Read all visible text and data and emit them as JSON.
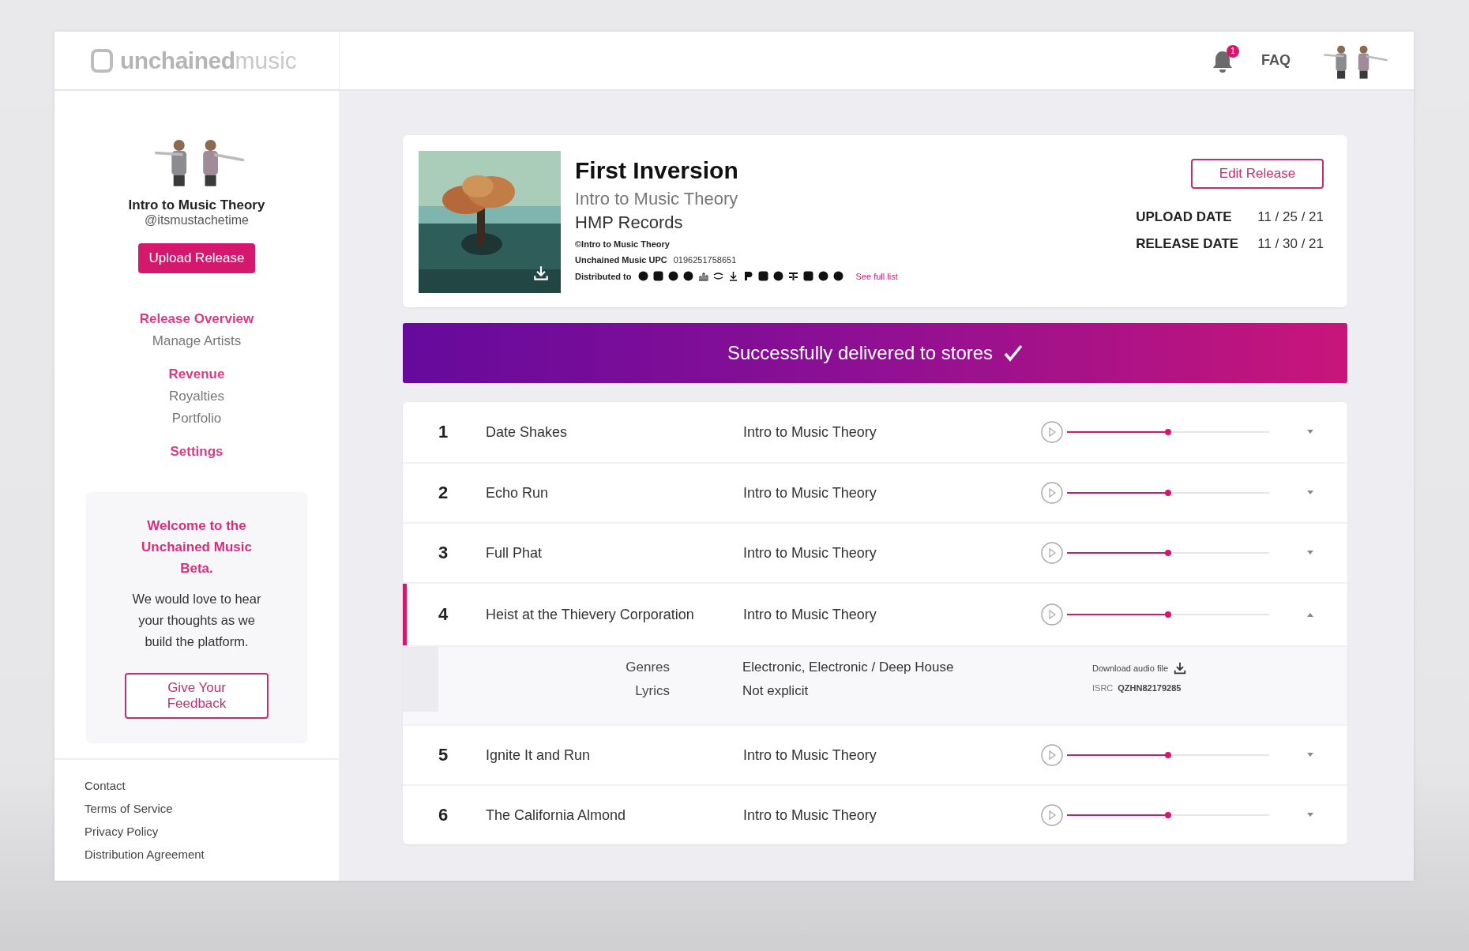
{
  "header": {
    "logo": {
      "bold": "unchained",
      "light": "music"
    },
    "notifications": {
      "badge": "1"
    },
    "faq": "FAQ"
  },
  "sidebar": {
    "profile": {
      "name": "Intro to Music Theory",
      "handle": "@itsmustachetime"
    },
    "upload_button": "Upload Release",
    "nav": [
      {
        "heading": "Release Overview",
        "items": [
          "Manage Artists"
        ]
      },
      {
        "heading": "Revenue",
        "items": [
          "Royalties",
          "Portfolio"
        ]
      },
      {
        "heading": "Settings"
      }
    ],
    "feedback": {
      "title": "Welcome to the Unchained Music Beta.",
      "text": "We would love to hear your thoughts as we build the platform.",
      "button": "Give Your Feedback"
    },
    "footer_links": [
      "Contact",
      "Terms of Service",
      "Privacy Policy",
      "Distribution Agreement"
    ]
  },
  "release": {
    "title": "First Inversion",
    "artist": "Intro to Music Theory",
    "label": "HMP Records",
    "copyright": "©Intro to Music Theory",
    "upc_label": "Unchained Music UPC",
    "upc": "0196251758651",
    "distributed_label": "Distributed to",
    "see_full_list": "See full list",
    "edit_button": "Edit Release",
    "dates": [
      {
        "label": "UPLOAD DATE",
        "value": "11 / 25 / 21"
      },
      {
        "label": "RELEASE DATE",
        "value": "11 / 30 / 21"
      }
    ]
  },
  "banner": {
    "text": "Successfully delivered to stores"
  },
  "tracks": [
    {
      "number": "1",
      "title": "Date Shakes",
      "artist": "Intro to Music Theory",
      "level": 0.5,
      "expanded": false
    },
    {
      "number": "2",
      "title": "Echo Run",
      "artist": "Intro to Music Theory",
      "level": 0.5,
      "expanded": false
    },
    {
      "number": "3",
      "title": "Full Phat",
      "artist": "Intro to Music Theory",
      "level": 0.5,
      "expanded": false
    },
    {
      "number": "4",
      "title": "Heist at the Thievery Corporation",
      "artist": "Intro to Music Theory",
      "level": 0.5,
      "expanded": true,
      "details": [
        {
          "label": "Genres",
          "value": "Electronic, Electronic / Deep House"
        },
        {
          "label": "Lyrics",
          "value": "Not explicit"
        }
      ],
      "download_label": "Download audio file",
      "isrc_label": "ISRC",
      "isrc": "QZHN82179285"
    },
    {
      "number": "5",
      "title": "Ignite It and Run",
      "artist": "Intro to Music Theory",
      "level": 0.5,
      "expanded": false
    },
    {
      "number": "6",
      "title": "The California Almond",
      "artist": "Intro to Music Theory",
      "level": 0.5,
      "expanded": false
    }
  ]
}
